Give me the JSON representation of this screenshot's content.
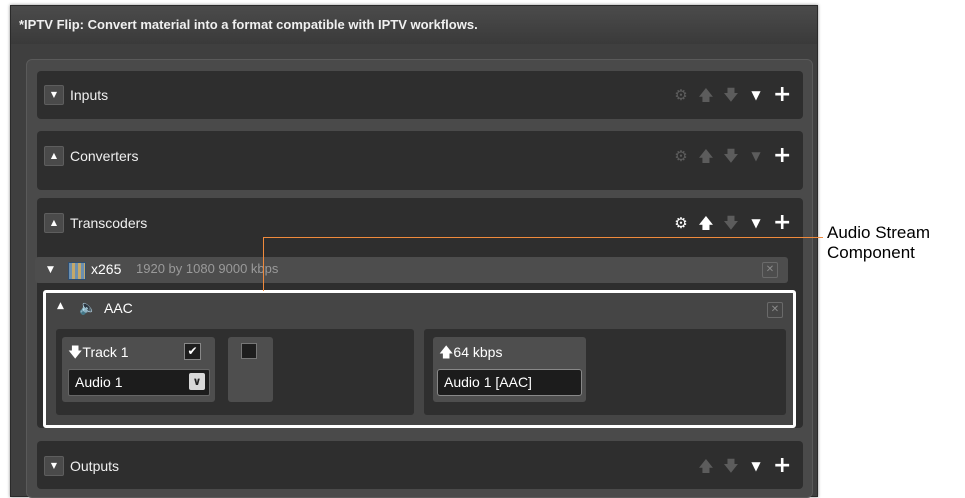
{
  "window": {
    "title": "*IPTV Flip: Convert material into a format compatible with IPTV workflows."
  },
  "sections": {
    "inputs": {
      "label": "Inputs"
    },
    "converters": {
      "label": "Converters"
    },
    "transcoders": {
      "label": "Transcoders"
    },
    "outputs": {
      "label": "Outputs"
    }
  },
  "video_stream": {
    "codec": "x265",
    "details": "1920 by 1080  9000 kbps"
  },
  "audio_stream": {
    "codec": "AAC",
    "track_label": "Track 1",
    "track_checked": "✔",
    "source_select_value": "Audio 1",
    "bitrate_label": "64 kbps",
    "output_field_value": "Audio 1 [AAC]"
  },
  "callout": {
    "line1": "Audio Stream",
    "line2": "Component"
  },
  "colors": {
    "callout_line": "#f08a3c",
    "codec_icon": "#f0b830"
  },
  "icons": [
    "gear-icon",
    "move-up-icon",
    "move-down-icon",
    "dropdown-icon",
    "add-icon",
    "close-icon",
    "film-icon",
    "speaker-icon"
  ]
}
